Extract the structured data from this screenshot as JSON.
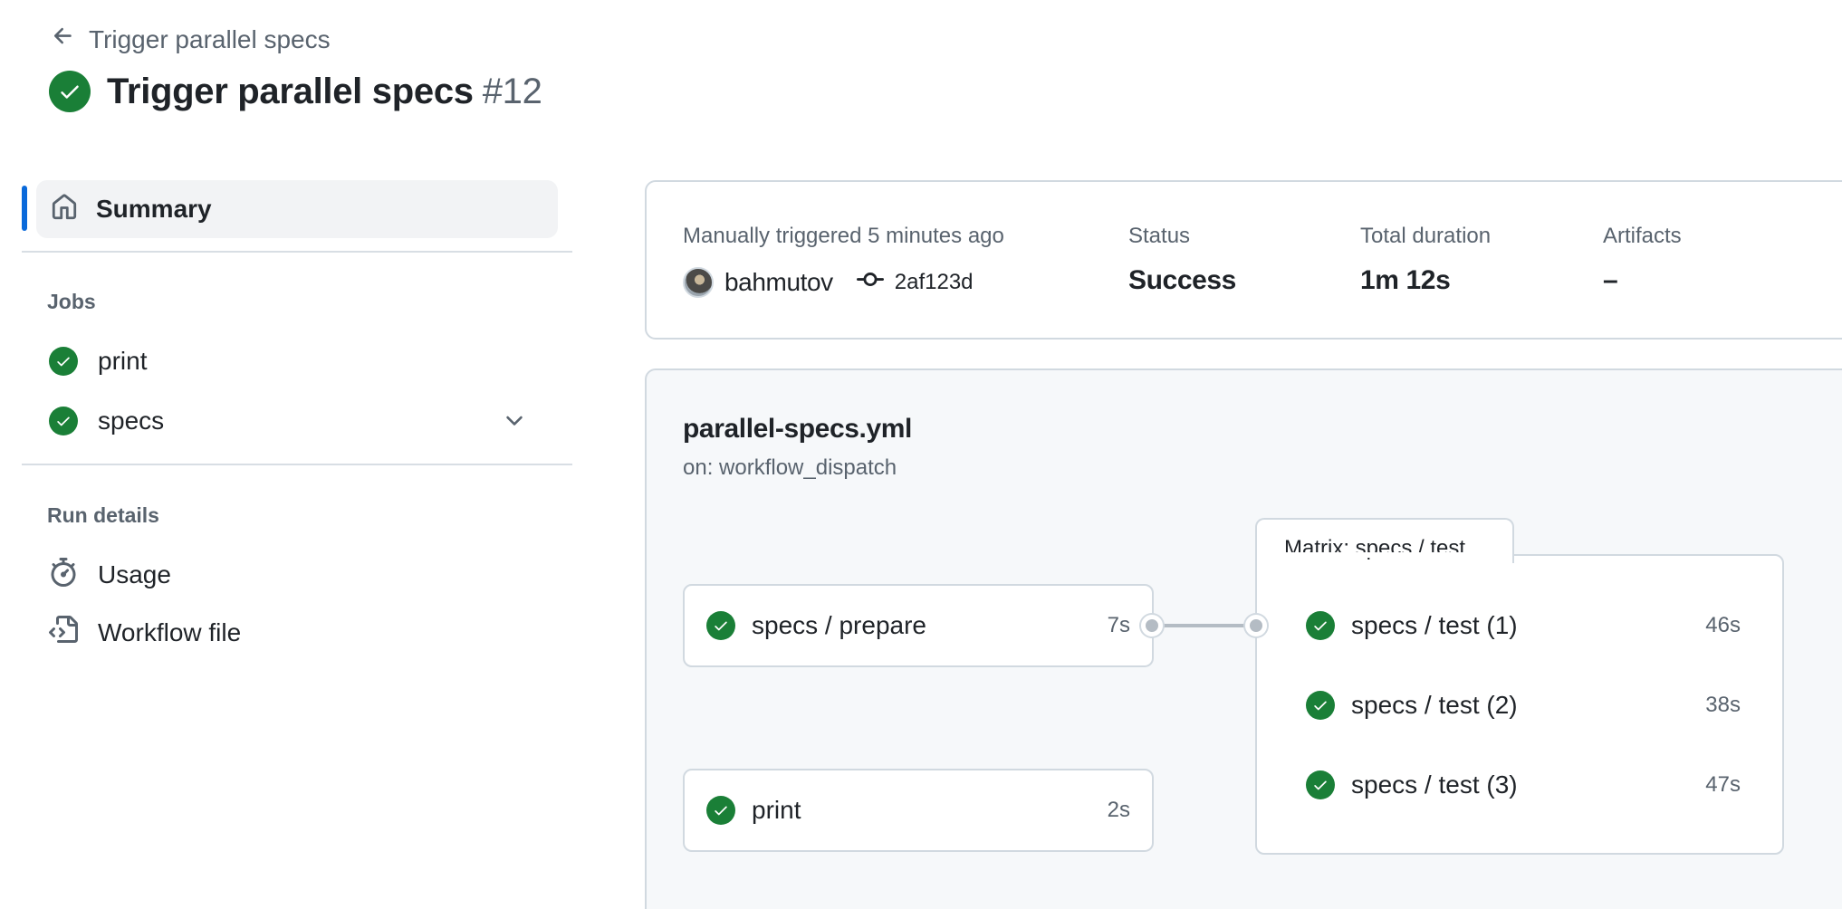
{
  "header": {
    "back_label": "Trigger parallel specs",
    "title": "Trigger parallel specs",
    "run_number": "#12"
  },
  "sidebar": {
    "summary_label": "Summary",
    "jobs_heading": "Jobs",
    "jobs": [
      {
        "label": "print"
      },
      {
        "label": "specs"
      }
    ],
    "run_details_heading": "Run details",
    "run_details": [
      {
        "label": "Usage"
      },
      {
        "label": "Workflow file"
      }
    ]
  },
  "summary": {
    "trigger_text": "Manually triggered 5 minutes ago",
    "actor": "bahmutov",
    "commit": "2af123d",
    "status_label": "Status",
    "status_value": "Success",
    "duration_label": "Total duration",
    "duration_value": "1m 12s",
    "artifacts_label": "Artifacts",
    "artifacts_value": "–"
  },
  "graph": {
    "workflow_file": "parallel-specs.yml",
    "trigger": "on: workflow_dispatch",
    "jobs": [
      {
        "name": "specs / prepare",
        "duration": "7s"
      },
      {
        "name": "print",
        "duration": "2s"
      }
    ],
    "matrix": {
      "title": "Matrix: specs / test",
      "jobs": [
        {
          "name": "specs / test (1)",
          "duration": "46s"
        },
        {
          "name": "specs / test (2)",
          "duration": "38s"
        },
        {
          "name": "specs / test (3)",
          "duration": "47s"
        }
      ]
    }
  },
  "colors": {
    "success": "#1a7f37",
    "accent": "#0969da",
    "muted_text": "#59636e",
    "border": "#d1d9e0"
  },
  "icons": [
    "arrow-left-icon",
    "check-circle-icon",
    "home-icon",
    "chevron-down-icon",
    "stopwatch-icon",
    "workflow-file-icon",
    "commit-icon"
  ]
}
